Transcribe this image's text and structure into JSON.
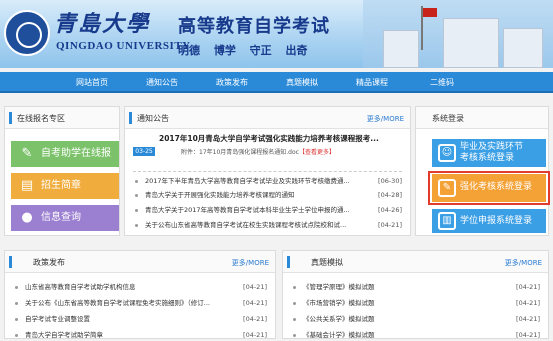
{
  "header": {
    "logo_cn": "青島大學",
    "logo_en": "QINGDAO UNIVERSITY",
    "site_title": "高等教育自学考试",
    "motto": "明德  博学  守正  出奇"
  },
  "nav": [
    "网站首页",
    "通知公告",
    "政策发布",
    "真题模拟",
    "精品课程",
    "二维码"
  ],
  "online_reg": {
    "title": "在线报名专区",
    "buttons": [
      {
        "label": "自考助学在线报名",
        "icon": "pencil-icon",
        "color": "#7cc26a"
      },
      {
        "label": "招生简章",
        "icon": "book-icon",
        "color": "#f0ad3d"
      },
      {
        "label": "信息查询",
        "icon": "search-icon",
        "color": "#9b7fd0"
      }
    ]
  },
  "notices": {
    "title": "通知公告",
    "more": "更多/MORE",
    "featured": {
      "title": "2017年10月青岛大学自学考试强化实践能力培养考核课程报考...",
      "date": "03-25",
      "attachment": "附件：17年10月青岛强化课程报名通知.doc",
      "link": "【查看更多】"
    },
    "items": [
      {
        "title": "2017年下半年青岛大学高等教育自学考试毕业及实践环节考核缴费通...",
        "date": "[06-30]"
      },
      {
        "title": "青岛大学关于开展强化实践能力培养考核课程的通知",
        "date": "[04-28]"
      },
      {
        "title": "青岛大学关于2017年高等教育自学考试本科毕业生学士学位申报的通...",
        "date": "[04-26]"
      },
      {
        "title": "关于公布山东省高等教育自学考试在校生实践课程考核试点院校和试...",
        "date": "[04-21]"
      }
    ]
  },
  "login": {
    "title": "系统登录",
    "buttons": [
      {
        "label1": "毕业及实践环节",
        "label2": "考核系统登录",
        "icon": "user-icon"
      },
      {
        "label1": "强化考核系统登录",
        "label2": "",
        "icon": "edit-icon"
      },
      {
        "label1": "学位申报系统登录",
        "label2": "",
        "icon": "doc-icon"
      }
    ]
  },
  "policy": {
    "title": "政策发布",
    "more": "更多/MORE",
    "items": [
      {
        "title": "山东省高等教育自学考试助学机构信息",
        "date": "[04-21]"
      },
      {
        "title": "关于公布《山东省高等教育自学考试课程免考实施细则》（修订...",
        "date": "[04-21]"
      },
      {
        "title": "自学考试专业调整设置",
        "date": "[04-21]"
      },
      {
        "title": "青岛大学自学考试助学简章",
        "date": "[04-21]"
      }
    ]
  },
  "exams": {
    "title": "真题模拟",
    "more": "更多/MORE",
    "items": [
      {
        "title": "《管理学原理》模拟试题",
        "date": "[04-21]"
      },
      {
        "title": "《市场营销学》模拟试题",
        "date": "[04-21]"
      },
      {
        "title": "《公共关系学》模拟试题",
        "date": "[04-21]"
      },
      {
        "title": "《基础会计学》模拟试题",
        "date": "[04-21]"
      }
    ]
  },
  "colors": {
    "nav": "#2a8ad8",
    "highlight_border": "#e23b2b",
    "login_btn": "#3b9fe6",
    "login_active": "#f4a236"
  }
}
